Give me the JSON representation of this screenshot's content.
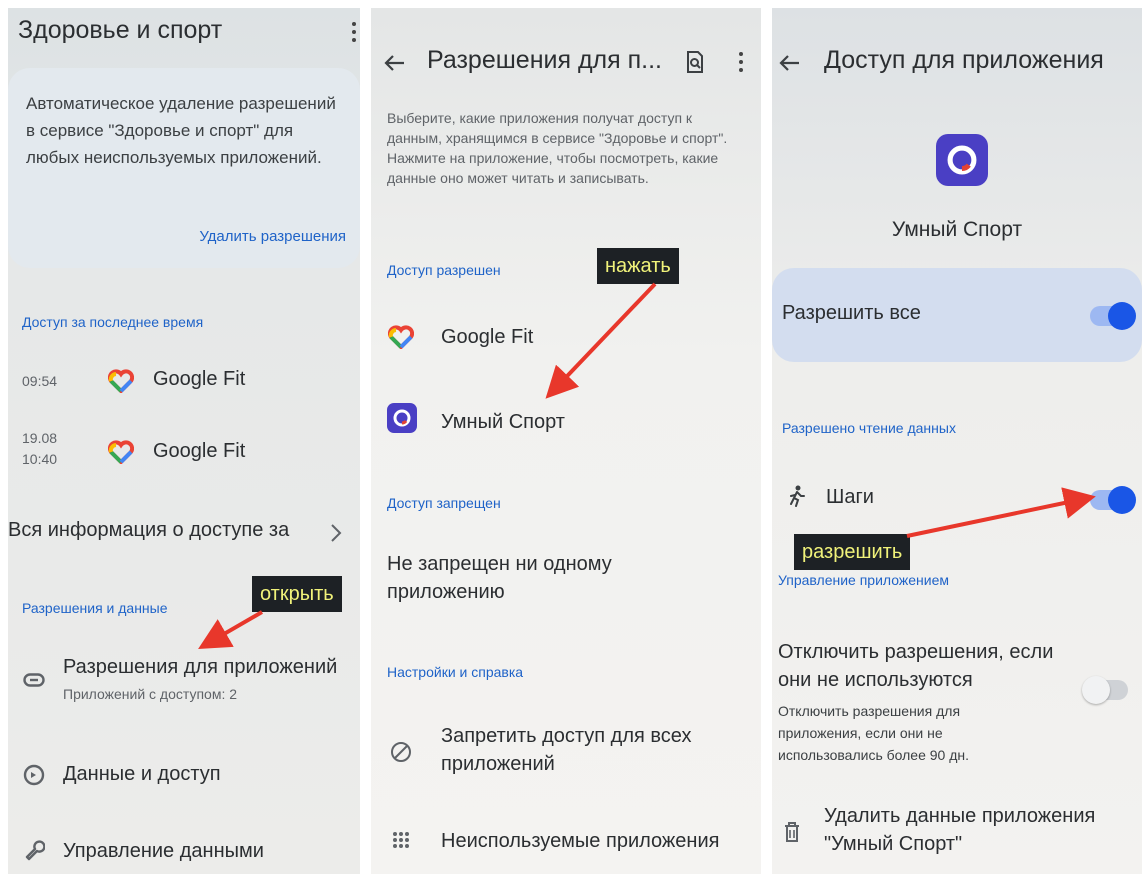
{
  "colors": {
    "accent_blue": "#1f63c8",
    "toggle_on": "#1a56e6",
    "annotation_bg": "#1d2125",
    "annotation_text": "#f0f27a",
    "arrow": "#e8372b"
  },
  "panel1": {
    "title": "Здоровье и спорт",
    "card_text": "Автоматическое удаление разрешений в сервисе \"Здоровье и спорт\" для любых неиспользуемых приложений.",
    "card_link": "Удалить разрешения",
    "recent_section": "Доступ за последнее время",
    "recent": [
      {
        "time": "09:54",
        "app": "Google Fit"
      },
      {
        "time": "19.08\n10:40",
        "app": "Google Fit"
      }
    ],
    "all_access": "Вся информация о доступе за",
    "perm_section": "Разрешения и данные",
    "app_perms": "Разрешения для приложений",
    "app_perms_sub": "Приложений с доступом: 2",
    "data_access": "Данные и доступ",
    "data_manage": "Управление данными",
    "annotation": "открыть"
  },
  "panel2": {
    "title": "Разрешения для п...",
    "description": "Выберите, какие приложения получат доступ к данным, хранящимся в сервисе \"Здоровье и спорт\". Нажмите на приложение, чтобы посмотреть, какие данные оно может читать и записывать.",
    "allowed_section": "Доступ разрешен",
    "apps": [
      "Google Fit",
      "Умный Спорт"
    ],
    "denied_section": "Доступ запрещен",
    "denied_text": "Не запрещен ни одному приложению",
    "settings_section": "Настройки и справка",
    "deny_all": "Запретить доступ для всех приложений",
    "unused_apps": "Неиспользуемые приложения",
    "annotation": "нажать"
  },
  "panel3": {
    "title": "Доступ для приложения",
    "app_name": "Умный Спорт",
    "allow_all": "Разрешить все",
    "read_section": "Разрешено чтение данных",
    "steps": "Шаги",
    "manage_section": "Управление приложением",
    "disable_perms": "Отключить разрешения, если они не используются",
    "disable_perms_sub": "Отключить разрешения для приложения, если они не использовались более 90 дн.",
    "delete_data": "Удалить данные приложения \"Умный Спорт\"",
    "annotation": "разрешить",
    "toggles": {
      "allow_all": true,
      "steps": true,
      "disable_unused": false
    }
  }
}
